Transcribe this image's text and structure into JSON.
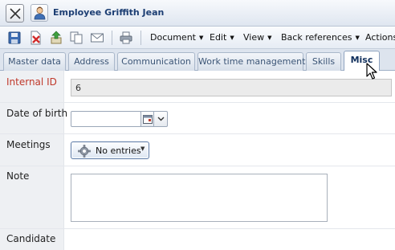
{
  "window": {
    "title": "Employee Griffith Jean",
    "close_icon": "close-icon",
    "entity_icon": "person-icon"
  },
  "toolbar": {
    "icons": [
      "save-icon",
      "delete-icon",
      "export-icon",
      "copy-icon",
      "mail-icon",
      "print-icon"
    ],
    "menus": [
      {
        "label": "Document"
      },
      {
        "label": "Edit"
      },
      {
        "label": "View"
      },
      {
        "label": "Back references"
      },
      {
        "label": "Actions"
      }
    ]
  },
  "tabs": [
    {
      "label": "Master data",
      "active": false
    },
    {
      "label": "Address",
      "active": false
    },
    {
      "label": "Communication",
      "active": false
    },
    {
      "label": "Work time management",
      "active": false
    },
    {
      "label": "Skills",
      "active": false
    },
    {
      "label": "Misc",
      "active": true
    }
  ],
  "form": {
    "internal_id": {
      "label": "Internal ID",
      "value": "6",
      "required": true
    },
    "date_of_birth": {
      "label": "Date of birth",
      "value": ""
    },
    "meetings": {
      "label": "Meetings",
      "button_label": "No entries"
    },
    "note": {
      "label": "Note",
      "value": ""
    },
    "candidate": {
      "label": "Candidate"
    }
  },
  "colors": {
    "required_label": "#c0392b",
    "title_text": "#1c3e73",
    "tab_background": "#dde4ee",
    "label_column": "#eef0f3"
  }
}
